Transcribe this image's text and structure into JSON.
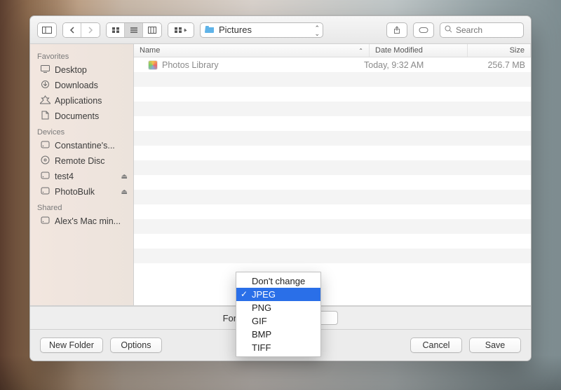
{
  "toolbar": {
    "path_label": "Pictures",
    "search_placeholder": "Search"
  },
  "sidebar": {
    "sections": {
      "favorites": "Favorites",
      "devices": "Devices",
      "shared": "Shared"
    },
    "favorites": [
      {
        "label": "Desktop",
        "icon": "desktop"
      },
      {
        "label": "Downloads",
        "icon": "downloads"
      },
      {
        "label": "Applications",
        "icon": "applications"
      },
      {
        "label": "Documents",
        "icon": "documents"
      }
    ],
    "devices": [
      {
        "label": "Constantine's...",
        "icon": "disk",
        "eject": false
      },
      {
        "label": "Remote Disc",
        "icon": "disc",
        "eject": false
      },
      {
        "label": "test4",
        "icon": "ext",
        "eject": true
      },
      {
        "label": "PhotoBulk",
        "icon": "ext",
        "eject": true
      }
    ],
    "shared": [
      {
        "label": "Alex's Mac min...",
        "icon": "disk",
        "eject": false
      }
    ]
  },
  "columns": {
    "name": "Name",
    "date": "Date Modified",
    "size": "Size"
  },
  "rows": [
    {
      "name": "Photos Library",
      "date": "Today, 9:32 AM",
      "size": "256.7 MB"
    }
  ],
  "format": {
    "label": "Format:",
    "options": [
      "Don't change",
      "JPEG",
      "PNG",
      "GIF",
      "BMP",
      "TIFF"
    ],
    "selected": "JPEG"
  },
  "buttons": {
    "new_folder": "New Folder",
    "options": "Options",
    "cancel": "Cancel",
    "save": "Save"
  }
}
